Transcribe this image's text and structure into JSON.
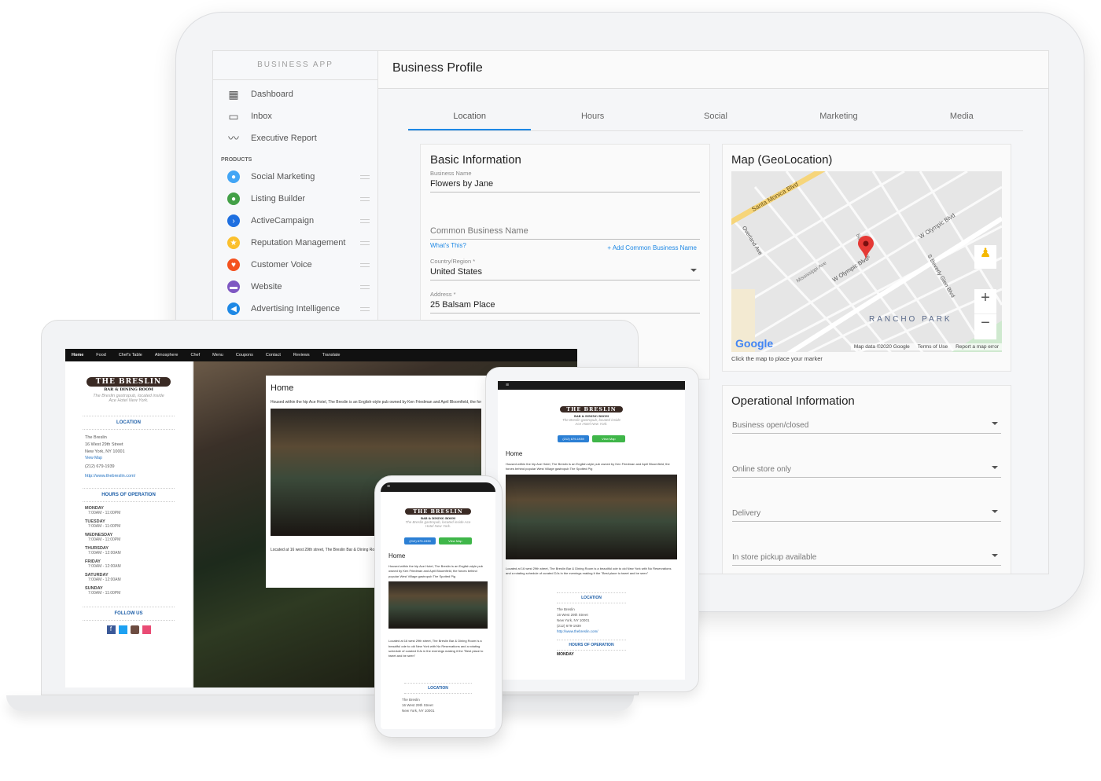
{
  "app": {
    "sidebar_title": "BUSINESS APP",
    "page_title": "Business Profile",
    "nav": [
      {
        "label": "Dashboard",
        "icon": "dashboard-icon"
      },
      {
        "label": "Inbox",
        "icon": "inbox-icon"
      },
      {
        "label": "Executive Report",
        "icon": "trend-icon"
      }
    ],
    "products_label": "PRODUCTS",
    "products": [
      {
        "label": "Social Marketing",
        "icon": "chat-bubble-icon",
        "color": "#42a5f5"
      },
      {
        "label": "Listing Builder",
        "icon": "location-pin-icon",
        "color": "#43a047"
      },
      {
        "label": "ActiveCampaign",
        "icon": "chevron-right-icon",
        "color": "#1e6fe0"
      },
      {
        "label": "Reputation Management",
        "icon": "star-icon",
        "color": "#fbc02d"
      },
      {
        "label": "Customer Voice",
        "icon": "heart-icon",
        "color": "#f4511e"
      },
      {
        "label": "Website",
        "icon": "browser-icon",
        "color": "#7e57c2"
      },
      {
        "label": "Advertising Intelligence",
        "icon": "megaphone-icon",
        "color": "#1e88e5"
      }
    ],
    "tabs": [
      "Location",
      "Hours",
      "Social",
      "Marketing",
      "Media"
    ],
    "active_tab": "Location",
    "basic": {
      "title": "Basic Information",
      "business_name_label": "Business Name",
      "business_name": "Flowers by Jane",
      "common_name_placeholder": "Common Business Name",
      "whats_this": "What's This?",
      "add_common": "+ Add Common Business Name",
      "country_label": "Country/Region *",
      "country": "United States",
      "address_label": "Address *",
      "address": "25 Balsam Place"
    },
    "map": {
      "title": "Map (GeoLocation)",
      "hint": "Click the map to place your marker",
      "labels": [
        "Santa Monica Blvd",
        "W Olympic Blvd",
        "W Olympic Blvd",
        "S Beverly Glen Blvd",
        "Overland Ave",
        "Mississippi Ave",
        "Balsam Ave",
        "RANCHO PARK"
      ],
      "attribution": "Map data ©2020 Google",
      "terms": "Terms of Use",
      "report": "Report a map error",
      "zoom_in": "+",
      "zoom_out": "−",
      "logo": "Google"
    },
    "operational": {
      "title": "Operational Information",
      "fields": [
        "Business open/closed",
        "Online store only",
        "Delivery",
        "In store pickup available"
      ]
    }
  },
  "site": {
    "nav": [
      "Home",
      "Food",
      "Chef's Table",
      "Atmosphere",
      "Chef",
      "Menu",
      "Coupons",
      "Contact",
      "Reviews",
      "Translate"
    ],
    "logo": "THE BRESLIN",
    "logo_sub": "BAR & DINING ROOM",
    "tagline": "The Breslin gastropub, located inside Ace Hotel New York.",
    "location_h": "LOCATION",
    "addr1": "The Breslin",
    "addr2": "16 West 29th Street",
    "addr3": "New York, NY 10001",
    "view_map": "View Map",
    "phone": "(212) 679-1939",
    "url": "http://www.thebreslin.com/",
    "hours_h": "HOURS OF OPERATION",
    "hours": [
      {
        "day": "MONDAY",
        "time": "7:00AM - 11:00PM"
      },
      {
        "day": "TUESDAY",
        "time": "7:00AM - 11:00PM"
      },
      {
        "day": "WEDNESDAY",
        "time": "7:00AM - 11:00PM"
      },
      {
        "day": "THURSDAY",
        "time": "7:00AM - 12:00AM"
      },
      {
        "day": "FRIDAY",
        "time": "7:00AM - 12:00AM"
      },
      {
        "day": "SATURDAY",
        "time": "7:00AM - 12:00AM"
      },
      {
        "day": "SUNDAY",
        "time": "7:00AM - 11:00PM"
      }
    ],
    "follow_h": "FOLLOW US",
    "social": [
      "facebook-icon",
      "twitter-icon",
      "instagram-icon",
      "foursquare-icon"
    ],
    "home_h": "Home",
    "intro": "Housed within the hip Ace Hotel, The Breslin is an English-style pub owned by Ken Friedman and April Bloomfield, the forces behind popular West Village gastropub The Spotted Pig",
    "body": "Located at 16 west 29th street, The Breslin Bar & Dining Room is a beautiful ode to old New York with No Reservations and a rotating schedule of curated DJs in the evenings making it the \"Best place to tweet and be seen\"",
    "btn_phone": "(212) 679-1939",
    "btn_map": "View Map",
    "monday_partial": "MONDAY"
  }
}
